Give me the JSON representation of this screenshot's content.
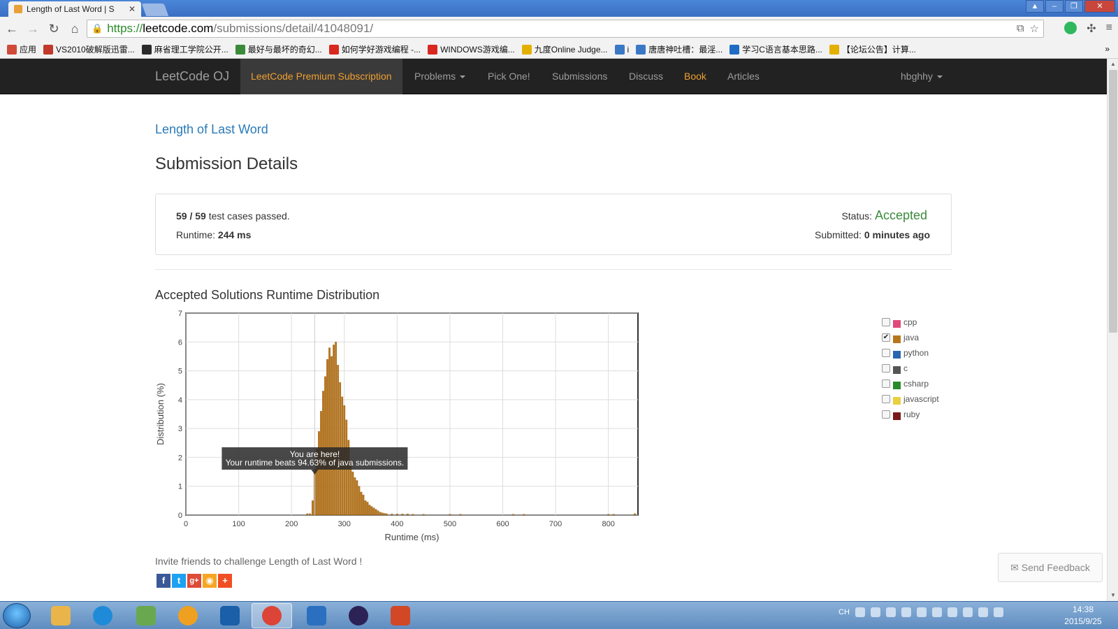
{
  "browser": {
    "tab_title": "Length of Last Word | S",
    "url_scheme": "https://",
    "url_host": "leetcode.com",
    "url_path": "/submissions/detail/41048091/",
    "bookmarks": [
      {
        "label": "应用",
        "color": "#d04a3a"
      },
      {
        "label": "VS2010破解版迅雷...",
        "color": "#c0392b"
      },
      {
        "label": "麻省理工学院公开...",
        "color": "#2b2b2b"
      },
      {
        "label": "最好与最坏的奇幻...",
        "color": "#3a8a3a"
      },
      {
        "label": "如何学好游戏编程 -...",
        "color": "#d9281f"
      },
      {
        "label": "WINDOWS游戏编...",
        "color": "#d9281f"
      },
      {
        "label": "九度Online Judge...",
        "color": "#e3b000"
      },
      {
        "label": "i",
        "color": "#3a78c6"
      },
      {
        "label": "唐唐神吐槽：最淫...",
        "color": "#3a78c6"
      },
      {
        "label": "学习C语言基本思路...",
        "color": "#1f6cc4"
      },
      {
        "label": "【论坛公告】计算...",
        "color": "#e3b000"
      }
    ],
    "bookmarks_more": "»"
  },
  "nav": {
    "brand": "LeetCode OJ",
    "premium": "LeetCode Premium Subscription",
    "problems": "Problems",
    "pick_one": "Pick One!",
    "submissions": "Submissions",
    "discuss": "Discuss",
    "book": "Book",
    "articles": "Articles",
    "user": "hbghhy"
  },
  "page": {
    "problem_link": "Length of Last Word",
    "title": "Submission Details",
    "passed_count": "59",
    "slash": "/",
    "total_count": "59",
    "passed_text": "test cases passed.",
    "runtime_label": "Runtime:",
    "runtime_value": "244 ms",
    "status_label": "Status:",
    "status_value": "Accepted",
    "submitted_label": "Submitted:",
    "submitted_value": "0 minutes ago",
    "dist_title": "Accepted Solutions Runtime Distribution",
    "invite": "Invite friends to challenge Length of Last Word !",
    "feedback": "Send Feedback",
    "tooltip_line1": "You are here!",
    "tooltip_line2": "Your runtime beats 94.63% of java submissions."
  },
  "legend": [
    {
      "name": "cpp",
      "color": "#e04a7a",
      "checked": false
    },
    {
      "name": "java",
      "color": "#b8761c",
      "checked": true
    },
    {
      "name": "python",
      "color": "#2a66b0",
      "checked": false
    },
    {
      "name": "c",
      "color": "#555555",
      "checked": false
    },
    {
      "name": "csharp",
      "color": "#2a8a2a",
      "checked": false
    },
    {
      "name": "javascript",
      "color": "#e8d040",
      "checked": false
    },
    {
      "name": "ruby",
      "color": "#7a1a1a",
      "checked": false
    }
  ],
  "chart_data": {
    "type": "bar",
    "xlabel": "Runtime (ms)",
    "ylabel": "Distribution (%)",
    "xlim": [
      0,
      856
    ],
    "ylim": [
      0,
      7
    ],
    "xticks": [
      0,
      100,
      200,
      300,
      400,
      500,
      600,
      700,
      800
    ],
    "yticks": [
      0,
      1,
      2,
      3,
      4,
      5,
      6,
      7
    ],
    "bar_color": "#b8761c",
    "marker_x": 244,
    "series": [
      {
        "name": "java",
        "x": [
          230,
          235,
          240,
          244,
          248,
          252,
          256,
          260,
          264,
          268,
          272,
          276,
          280,
          284,
          288,
          292,
          296,
          300,
          304,
          308,
          312,
          316,
          320,
          324,
          328,
          332,
          336,
          340,
          344,
          348,
          352,
          356,
          360,
          364,
          368,
          372,
          376,
          380,
          390,
          400,
          410,
          420,
          430,
          450,
          500,
          520,
          620,
          640,
          800,
          810,
          850
        ],
        "values": [
          0.05,
          0.05,
          0.5,
          1.6,
          2.3,
          2.9,
          3.6,
          4.3,
          4.8,
          5.4,
          5.8,
          5.5,
          5.9,
          6.0,
          5.2,
          4.6,
          4.1,
          3.8,
          3.3,
          2.6,
          1.9,
          1.5,
          1.3,
          1.2,
          1.0,
          0.8,
          0.7,
          0.5,
          0.45,
          0.35,
          0.3,
          0.25,
          0.2,
          0.15,
          0.1,
          0.08,
          0.06,
          0.05,
          0.04,
          0.04,
          0.04,
          0.04,
          0.03,
          0.03,
          0.03,
          0.03,
          0.03,
          0.03,
          0.03,
          0.03,
          0.05
        ]
      }
    ]
  },
  "taskbar": {
    "apps": [
      {
        "name": "explorer",
        "color": "#e9b54a"
      },
      {
        "name": "ie",
        "color": "#1f8bd8"
      },
      {
        "name": "notepad",
        "color": "#6aa84f"
      },
      {
        "name": "media",
        "color": "#f0a020"
      },
      {
        "name": "powershell",
        "color": "#1a5fa8"
      },
      {
        "name": "chrome",
        "color": "#db4437"
      },
      {
        "name": "vs",
        "color": "#2a6fc0"
      },
      {
        "name": "eclipse",
        "color": "#2c2255"
      },
      {
        "name": "powerpoint",
        "color": "#d24726"
      }
    ],
    "tray_text": "CH",
    "time": "14:38",
    "date": "2015/9/25"
  }
}
